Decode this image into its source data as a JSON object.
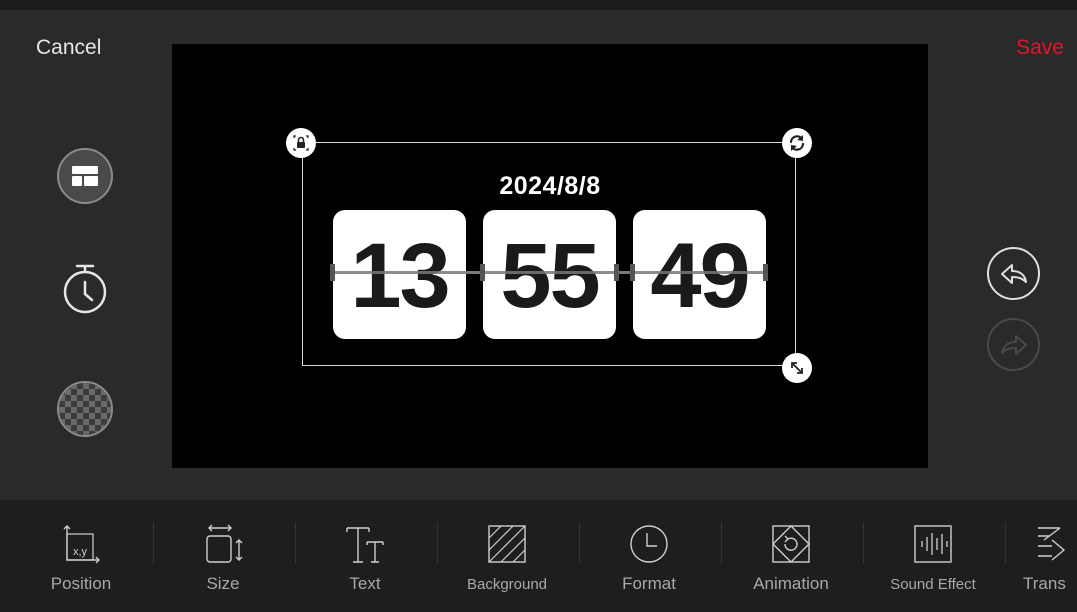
{
  "header": {
    "cancel_label": "Cancel",
    "save_label": "Save"
  },
  "clock": {
    "date": "2024/8/8",
    "hours": "13",
    "minutes": "55",
    "seconds": "49"
  },
  "handles": {
    "top_left": "lock-icon",
    "top_right": "rotate-icon",
    "bottom_right": "resize-icon"
  },
  "side_tools": [
    "layout-icon",
    "timer-icon",
    "transparency-icon"
  ],
  "history": {
    "undo": "undo-icon",
    "redo": "redo-icon",
    "redo_enabled": false
  },
  "toolbar": {
    "items": [
      {
        "label": "Position",
        "icon": "position-icon",
        "coord_text": "x,y"
      },
      {
        "label": "Size",
        "icon": "size-icon"
      },
      {
        "label": "Text",
        "icon": "text-icon"
      },
      {
        "label": "Background",
        "icon": "background-icon"
      },
      {
        "label": "Format",
        "icon": "format-clock-icon"
      },
      {
        "label": "Animation",
        "icon": "animation-icon"
      },
      {
        "label": "Sound Effect",
        "icon": "sound-effect-icon"
      },
      {
        "label": "Trans",
        "icon": "transition-icon"
      }
    ]
  },
  "colors": {
    "accent": "#e0162b",
    "background": "#2a2a2a",
    "canvas": "#000000",
    "card": "#ffffff"
  }
}
